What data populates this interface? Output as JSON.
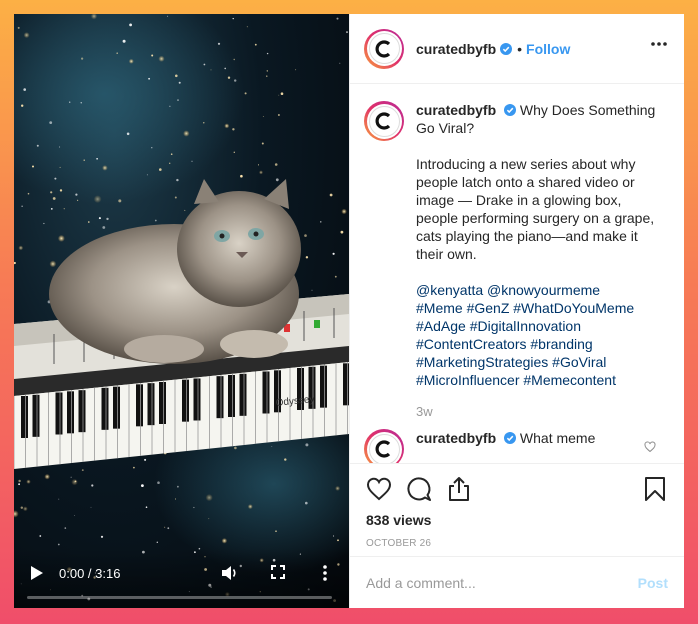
{
  "video": {
    "time_display": "0:00 / 3:16",
    "progress": 0,
    "keyboard_brand": "Odyssey"
  },
  "post": {
    "username": "curatedbyfb",
    "follow_label": "Follow",
    "separator": "•"
  },
  "caption": {
    "username": "curatedbyfb",
    "title": "Why Does Something Go Viral?",
    "paragraph": "Introducing a new series about why people latch onto a shared video or image — Drake in a glowing box, people performing surgery on a grape, cats playing the piano—and make it their own.",
    "mentions": "@kenyatta @knowyourmeme",
    "hashtags_1": "#Meme #GenZ #WhatDoYouMeme",
    "hashtags_2": "#AdAge #DigitalInnovation",
    "hashtags_3": "#ContentCreators #branding",
    "hashtags_4": "#MarketingStrategies #GoViral",
    "hashtags_5": "#MicroInfluencer #Memecontent",
    "age": "3w"
  },
  "comment": {
    "username": "curatedbyfb",
    "text": "What meme"
  },
  "stats": {
    "views": "838 views",
    "date": "OCTOBER 26"
  },
  "add_comment": {
    "placeholder": "Add a comment...",
    "post_label": "Post"
  },
  "colors": {
    "link": "#3897f0",
    "hashtag": "#003569",
    "post_disabled": "#b2dffc"
  }
}
